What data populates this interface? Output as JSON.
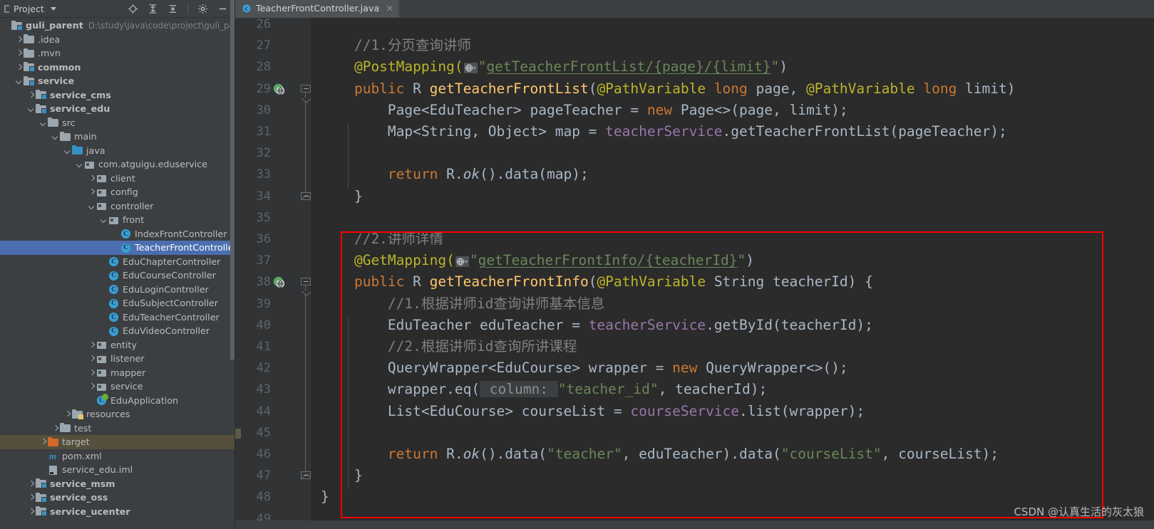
{
  "toolwindow": {
    "title": "Project",
    "actions": [
      {
        "name": "locate-icon",
        "label": "Select Opened File"
      },
      {
        "name": "expand-all-icon",
        "label": "Expand All"
      },
      {
        "name": "collapse-all-icon",
        "label": "Collapse All"
      },
      {
        "name": "gear-icon",
        "label": "Settings"
      },
      {
        "name": "minimize-icon",
        "label": "Hide"
      }
    ]
  },
  "tree": {
    "root": {
      "label": "guli_parent",
      "path": "D:\\study\\java\\code\\project\\guli_parent"
    },
    "items": [
      {
        "label": "guli_parent",
        "path": "D:\\study\\java\\code\\project\\guli_parent",
        "indent": 0,
        "arrow": "none",
        "icon": "module-folder",
        "bold": true
      },
      {
        "label": ".idea",
        "indent": 1,
        "arrow": "right",
        "icon": "folder"
      },
      {
        "label": ".mvn",
        "indent": 1,
        "arrow": "right",
        "icon": "folder"
      },
      {
        "label": "common",
        "indent": 1,
        "arrow": "right",
        "icon": "module-folder",
        "bold": true
      },
      {
        "label": "service",
        "indent": 1,
        "arrow": "down",
        "icon": "module-folder",
        "bold": true
      },
      {
        "label": "service_cms",
        "indent": 2,
        "arrow": "right",
        "icon": "module-folder",
        "bold": true
      },
      {
        "label": "service_edu",
        "indent": 2,
        "arrow": "down",
        "icon": "module-folder",
        "bold": true
      },
      {
        "label": "src",
        "indent": 3,
        "arrow": "down",
        "icon": "folder"
      },
      {
        "label": "main",
        "indent": 4,
        "arrow": "down",
        "icon": "folder"
      },
      {
        "label": "java",
        "indent": 5,
        "arrow": "down",
        "icon": "source-folder"
      },
      {
        "label": "com.atguigu.eduservice",
        "indent": 6,
        "arrow": "down",
        "icon": "package"
      },
      {
        "label": "client",
        "indent": 7,
        "arrow": "right",
        "icon": "package"
      },
      {
        "label": "config",
        "indent": 7,
        "arrow": "right",
        "icon": "package"
      },
      {
        "label": "controller",
        "indent": 7,
        "arrow": "down",
        "icon": "package"
      },
      {
        "label": "front",
        "indent": 8,
        "arrow": "down",
        "icon": "package"
      },
      {
        "label": "IndexFrontController",
        "indent": 9,
        "arrow": "none",
        "icon": "java-class"
      },
      {
        "label": "TeacherFrontController",
        "indent": 9,
        "arrow": "none",
        "icon": "java-class",
        "selected": true
      },
      {
        "label": "EduChapterController",
        "indent": 8,
        "arrow": "none",
        "icon": "java-class"
      },
      {
        "label": "EduCourseController",
        "indent": 8,
        "arrow": "none",
        "icon": "java-class"
      },
      {
        "label": "EduLoginController",
        "indent": 8,
        "arrow": "none",
        "icon": "java-class"
      },
      {
        "label": "EduSubjectController",
        "indent": 8,
        "arrow": "none",
        "icon": "java-class"
      },
      {
        "label": "EduTeacherController",
        "indent": 8,
        "arrow": "none",
        "icon": "java-class"
      },
      {
        "label": "EduVideoController",
        "indent": 8,
        "arrow": "none",
        "icon": "java-class"
      },
      {
        "label": "entity",
        "indent": 7,
        "arrow": "right",
        "icon": "package"
      },
      {
        "label": "listener",
        "indent": 7,
        "arrow": "right",
        "icon": "package"
      },
      {
        "label": "mapper",
        "indent": 7,
        "arrow": "right",
        "icon": "package"
      },
      {
        "label": "service",
        "indent": 7,
        "arrow": "right",
        "icon": "package"
      },
      {
        "label": "EduApplication",
        "indent": 7,
        "arrow": "none",
        "icon": "spring-boot-class"
      },
      {
        "label": "resources",
        "indent": 5,
        "arrow": "right",
        "icon": "resources-folder"
      },
      {
        "label": "test",
        "indent": 4,
        "arrow": "right",
        "icon": "folder"
      },
      {
        "label": "target",
        "indent": 3,
        "arrow": "right",
        "icon": "excluded-folder",
        "highlighted": true
      },
      {
        "label": "pom.xml",
        "indent": 3,
        "arrow": "none",
        "icon": "maven-pom"
      },
      {
        "label": "service_edu.iml",
        "indent": 3,
        "arrow": "none",
        "icon": "iml-file"
      },
      {
        "label": "service_msm",
        "indent": 2,
        "arrow": "right",
        "icon": "module-folder",
        "bold": true
      },
      {
        "label": "service_oss",
        "indent": 2,
        "arrow": "right",
        "icon": "module-folder",
        "bold": true
      },
      {
        "label": "service_ucenter",
        "indent": 2,
        "arrow": "right",
        "icon": "module-folder",
        "bold": true
      }
    ]
  },
  "editor": {
    "tab": {
      "label": "TeacherFrontController.java",
      "icon": "java-class-icon",
      "close": "×"
    },
    "first_line_number": 26,
    "lines": [
      {
        "n": 26,
        "segments": []
      },
      {
        "n": 27,
        "segments": [
          {
            "t": "cmt",
            "v": "    //1.分页查询讲师"
          }
        ]
      },
      {
        "n": 28,
        "segments": [
          {
            "t": "ann",
            "v": "    @PostMapping("
          },
          {
            "t": "webicon",
            "v": ""
          },
          {
            "t": "str",
            "v": "\""
          },
          {
            "t": "stru",
            "v": "getTeacherFrontList/{page}/{limit}"
          },
          {
            "t": "str",
            "v": "\""
          },
          {
            "t": "txt",
            "v": ")"
          }
        ]
      },
      {
        "n": 29,
        "segments": [
          {
            "t": "kw",
            "v": "    public "
          },
          {
            "t": "txt",
            "v": "R "
          },
          {
            "t": "def",
            "v": "getTeacherFrontList"
          },
          {
            "t": "txt",
            "v": "("
          },
          {
            "t": "ann",
            "v": "@PathVariable "
          },
          {
            "t": "kw",
            "v": "long "
          },
          {
            "t": "txt",
            "v": "page, "
          },
          {
            "t": "ann",
            "v": "@PathVariable "
          },
          {
            "t": "kw",
            "v": "long "
          },
          {
            "t": "txt",
            "v": "limit)"
          }
        ],
        "gutter_run": true,
        "fold_top": true
      },
      {
        "n": 30,
        "segments": [
          {
            "t": "txt",
            "v": "        Page<EduTeacher> pageTeacher = "
          },
          {
            "t": "kw",
            "v": "new "
          },
          {
            "t": "txt",
            "v": "Page<>(page, limit);"
          }
        ]
      },
      {
        "n": 31,
        "segments": [
          {
            "t": "txt",
            "v": "        Map<String, Object> map = "
          },
          {
            "t": "fld",
            "v": "teacherService"
          },
          {
            "t": "txt",
            "v": ".getTeacherFrontList(pageTeacher);"
          }
        ]
      },
      {
        "n": 32,
        "segments": []
      },
      {
        "n": 33,
        "segments": [
          {
            "t": "kw",
            "v": "        return "
          },
          {
            "t": "txt",
            "v": "R."
          },
          {
            "t": "it",
            "v": "ok"
          },
          {
            "t": "txt",
            "v": "().data(map);"
          }
        ]
      },
      {
        "n": 34,
        "segments": [
          {
            "t": "txt",
            "v": "    }"
          }
        ],
        "fold_bot": true
      },
      {
        "n": 35,
        "segments": []
      },
      {
        "n": 36,
        "segments": [
          {
            "t": "cmt",
            "v": "    //2.讲师详情"
          }
        ]
      },
      {
        "n": 37,
        "segments": [
          {
            "t": "ann",
            "v": "    @GetMapping("
          },
          {
            "t": "webicon",
            "v": ""
          },
          {
            "t": "str",
            "v": "\""
          },
          {
            "t": "stru",
            "v": "getTeacherFrontInfo/{teacherId}"
          },
          {
            "t": "str",
            "v": "\""
          },
          {
            "t": "txt",
            "v": ")"
          }
        ]
      },
      {
        "n": 38,
        "segments": [
          {
            "t": "kw",
            "v": "    public "
          },
          {
            "t": "txt",
            "v": "R "
          },
          {
            "t": "def",
            "v": "getTeacherFrontInfo"
          },
          {
            "t": "txt",
            "v": "("
          },
          {
            "t": "ann",
            "v": "@PathVariable "
          },
          {
            "t": "txt",
            "v": "String teacherId) {"
          }
        ],
        "gutter_run": true,
        "fold_top": true
      },
      {
        "n": 39,
        "segments": [
          {
            "t": "cmt",
            "v": "        //1.根据讲师id查询讲师基本信息"
          }
        ]
      },
      {
        "n": 40,
        "segments": [
          {
            "t": "txt",
            "v": "        EduTeacher eduTeacher = "
          },
          {
            "t": "fld",
            "v": "teacherService"
          },
          {
            "t": "txt",
            "v": ".getById(teacherId);"
          }
        ]
      },
      {
        "n": 41,
        "segments": [
          {
            "t": "cmt",
            "v": "        //2.根据讲师id查询所讲课程"
          }
        ]
      },
      {
        "n": 42,
        "segments": [
          {
            "t": "txt",
            "v": "        QueryWrapper<EduCourse> wrapper = "
          },
          {
            "t": "kw",
            "v": "new "
          },
          {
            "t": "txt",
            "v": "QueryWrapper<>();"
          }
        ]
      },
      {
        "n": 43,
        "segments": [
          {
            "t": "txt",
            "v": "        wrapper.eq("
          },
          {
            "t": "hint",
            "v": " column: "
          },
          {
            "t": "str",
            "v": "\"teacher_id\""
          },
          {
            "t": "txt",
            "v": ", teacherId);"
          }
        ]
      },
      {
        "n": 44,
        "segments": [
          {
            "t": "txt",
            "v": "        List<EduCourse> courseList = "
          },
          {
            "t": "fld",
            "v": "courseService"
          },
          {
            "t": "txt",
            "v": ".list(wrapper);"
          }
        ]
      },
      {
        "n": 45,
        "segments": []
      },
      {
        "n": 46,
        "segments": [
          {
            "t": "kw",
            "v": "        return "
          },
          {
            "t": "txt",
            "v": "R."
          },
          {
            "t": "it",
            "v": "ok"
          },
          {
            "t": "txt",
            "v": "().data("
          },
          {
            "t": "str",
            "v": "\"teacher\""
          },
          {
            "t": "txt",
            "v": ", eduTeacher).data("
          },
          {
            "t": "str",
            "v": "\"courseList\""
          },
          {
            "t": "txt",
            "v": ", courseList);"
          }
        ]
      },
      {
        "n": 47,
        "segments": [
          {
            "t": "txt",
            "v": "    }"
          }
        ],
        "fold_bot": true
      },
      {
        "n": 48,
        "segments": [
          {
            "t": "txt",
            "v": "}"
          }
        ]
      },
      {
        "n": 49,
        "segments": []
      }
    ],
    "annotation_box": {
      "label": "red-highlight-box",
      "color": "#ff0000"
    }
  },
  "watermark": {
    "text": "CSDN @认真生活的灰太狼"
  },
  "colors": {
    "sidebar_bg": "#3c3f41",
    "editor_bg": "#2b2b2b",
    "gutter_bg": "#313335",
    "selection": "#4b6eaf",
    "highlight": "#54503c",
    "accent_red": "#ff0000"
  }
}
